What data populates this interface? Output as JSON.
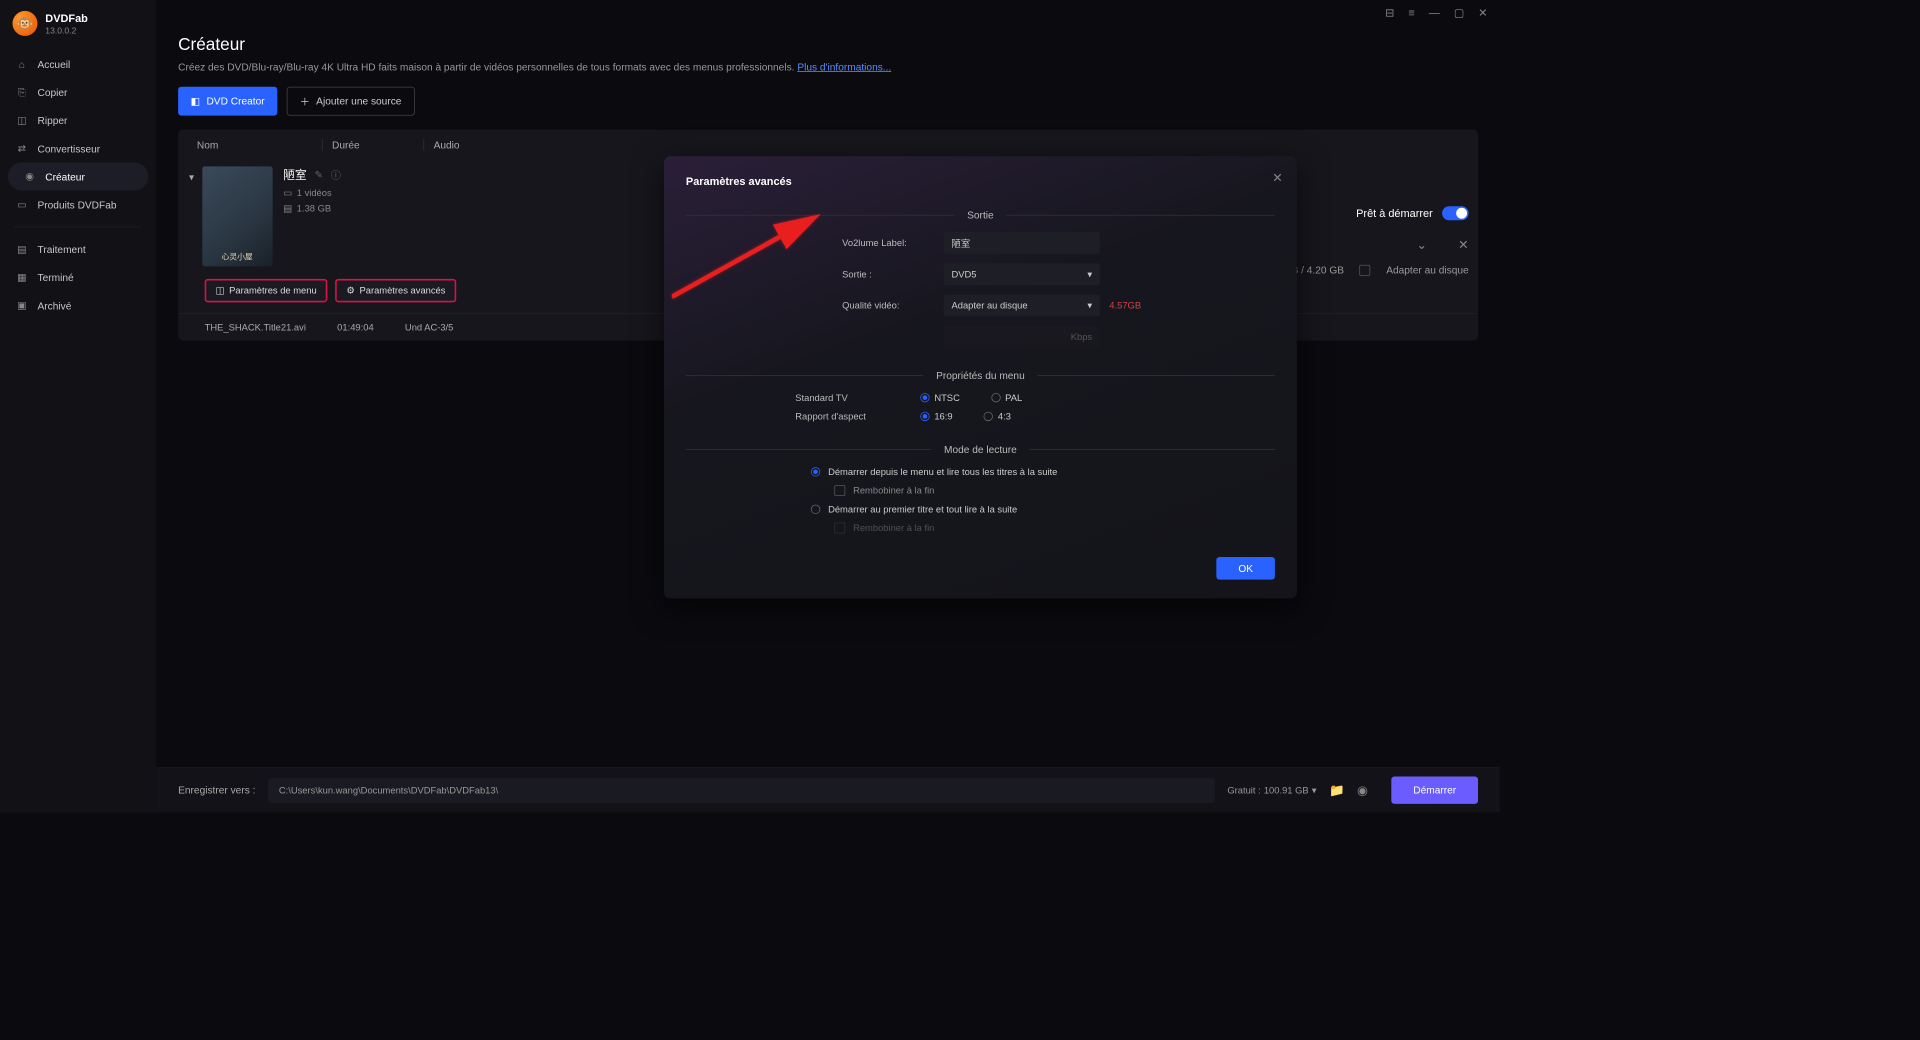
{
  "app": {
    "name": "DVDFab",
    "version": "13.0.0.2"
  },
  "sidebar": {
    "items": [
      {
        "label": "Accueil"
      },
      {
        "label": "Copier"
      },
      {
        "label": "Ripper"
      },
      {
        "label": "Convertisseur"
      },
      {
        "label": "Créateur"
      },
      {
        "label": "Produits DVDFab"
      },
      {
        "label": "Traitement"
      },
      {
        "label": "Terminé"
      },
      {
        "label": "Archivé"
      }
    ]
  },
  "page": {
    "title": "Créateur",
    "desc": "Créez des DVD/Blu-ray/Blu-ray 4K Ultra HD faits maison à partir de vidéos personnelles de tous formats avec des menus professionnels. ",
    "more": "Plus d'informations..."
  },
  "toolbar": {
    "creator": "DVD Creator",
    "add": "Ajouter une source"
  },
  "table": {
    "headers": {
      "name": "Nom",
      "duration": "Durée",
      "audio": "Audio"
    },
    "item": {
      "title": "陋室",
      "videos": "1 vidéos",
      "size": "1.38 GB",
      "menu_btn": "Paramètres de menu",
      "adv_btn": "Paramètres avancés",
      "file": "THE_SHACK.Title21.avi",
      "duration": "01:49:04",
      "audio": "Und  AC-3/5"
    }
  },
  "right": {
    "ready": "Prêt à démarrer",
    "size": "7 GB / 4.20 GB",
    "fit": "Adapter au disque"
  },
  "modal": {
    "title": "Paramètres avancés",
    "section_output": "Sortie",
    "volume_label_lbl": "Vo2lume Label:",
    "volume_label_val": "陋室",
    "output_lbl": "Sortie :",
    "output_val": "DVD5",
    "quality_lbl": "Qualité vidéo:",
    "quality_val": "Adapter au disque",
    "quality_size": "4.57GB",
    "kbps": "Kbps",
    "section_menu": "Propriétés du menu",
    "tv_lbl": "Standard TV",
    "tv_ntsc": "NTSC",
    "tv_pal": "PAL",
    "aspect_lbl": "Rapport d'aspect",
    "aspect_169": "16:9",
    "aspect_43": "4:3",
    "section_play": "Mode de lecture",
    "play1": "Démarrer depuis le menu et lire tous les titres à la suite",
    "rewind1": "Rembobiner à la fin",
    "play2": "Démarrer au premier titre et tout lire à la suite",
    "rewind2": "Rembobiner à la fin",
    "ok": "OK"
  },
  "footer": {
    "save_lbl": "Enregistrer vers :",
    "path": "C:\\Users\\kun.wang\\Documents\\DVDFab\\DVDFab13\\",
    "free_lbl": "Gratuit :",
    "free_val": "100.91 GB",
    "start": "Démarrer"
  }
}
